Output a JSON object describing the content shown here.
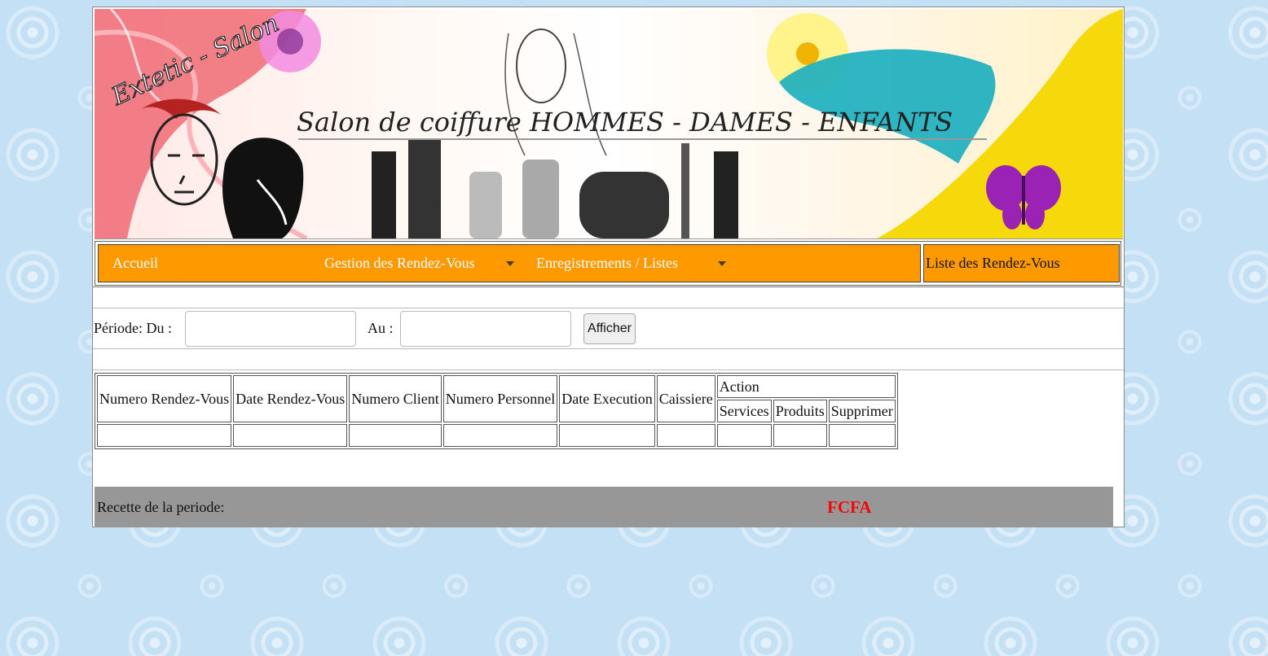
{
  "banner": {
    "logo_text": "Extetic - Salon",
    "headline": "Salon de coiffure HOMMES - DAMES - ENFANTS"
  },
  "nav": {
    "items": [
      {
        "label": "Accueil",
        "has_dropdown": false
      },
      {
        "label": "Gestion des Rendez-Vous",
        "has_dropdown": true
      },
      {
        "label": "Enregistrements / Listes",
        "has_dropdown": true
      }
    ],
    "page_title": "Liste des Rendez-Vous"
  },
  "filter": {
    "periode_label": "Période: Du :",
    "au_label": "Au :",
    "date_from_value": "",
    "date_to_value": "",
    "submit_label": "Afficher"
  },
  "table": {
    "headers": [
      "Numero Rendez-Vous",
      "Date Rendez-Vous",
      "Numero Client",
      "Numero Personnel",
      "Date Execution",
      "Caissiere"
    ],
    "action_header": "Action",
    "action_subheaders": [
      "Services",
      "Produits",
      "Supprimer"
    ],
    "rows": [
      [
        "",
        "",
        "",
        "",
        "",
        "",
        "",
        "",
        ""
      ]
    ]
  },
  "footer": {
    "recette_label": "Recette de la periode:",
    "recette_value": "",
    "currency": "FCFA"
  },
  "colors": {
    "nav_orange": "#ff9900",
    "footer_gray": "#979797",
    "currency_red": "#ff0000",
    "page_background": "#c4e0f4"
  }
}
